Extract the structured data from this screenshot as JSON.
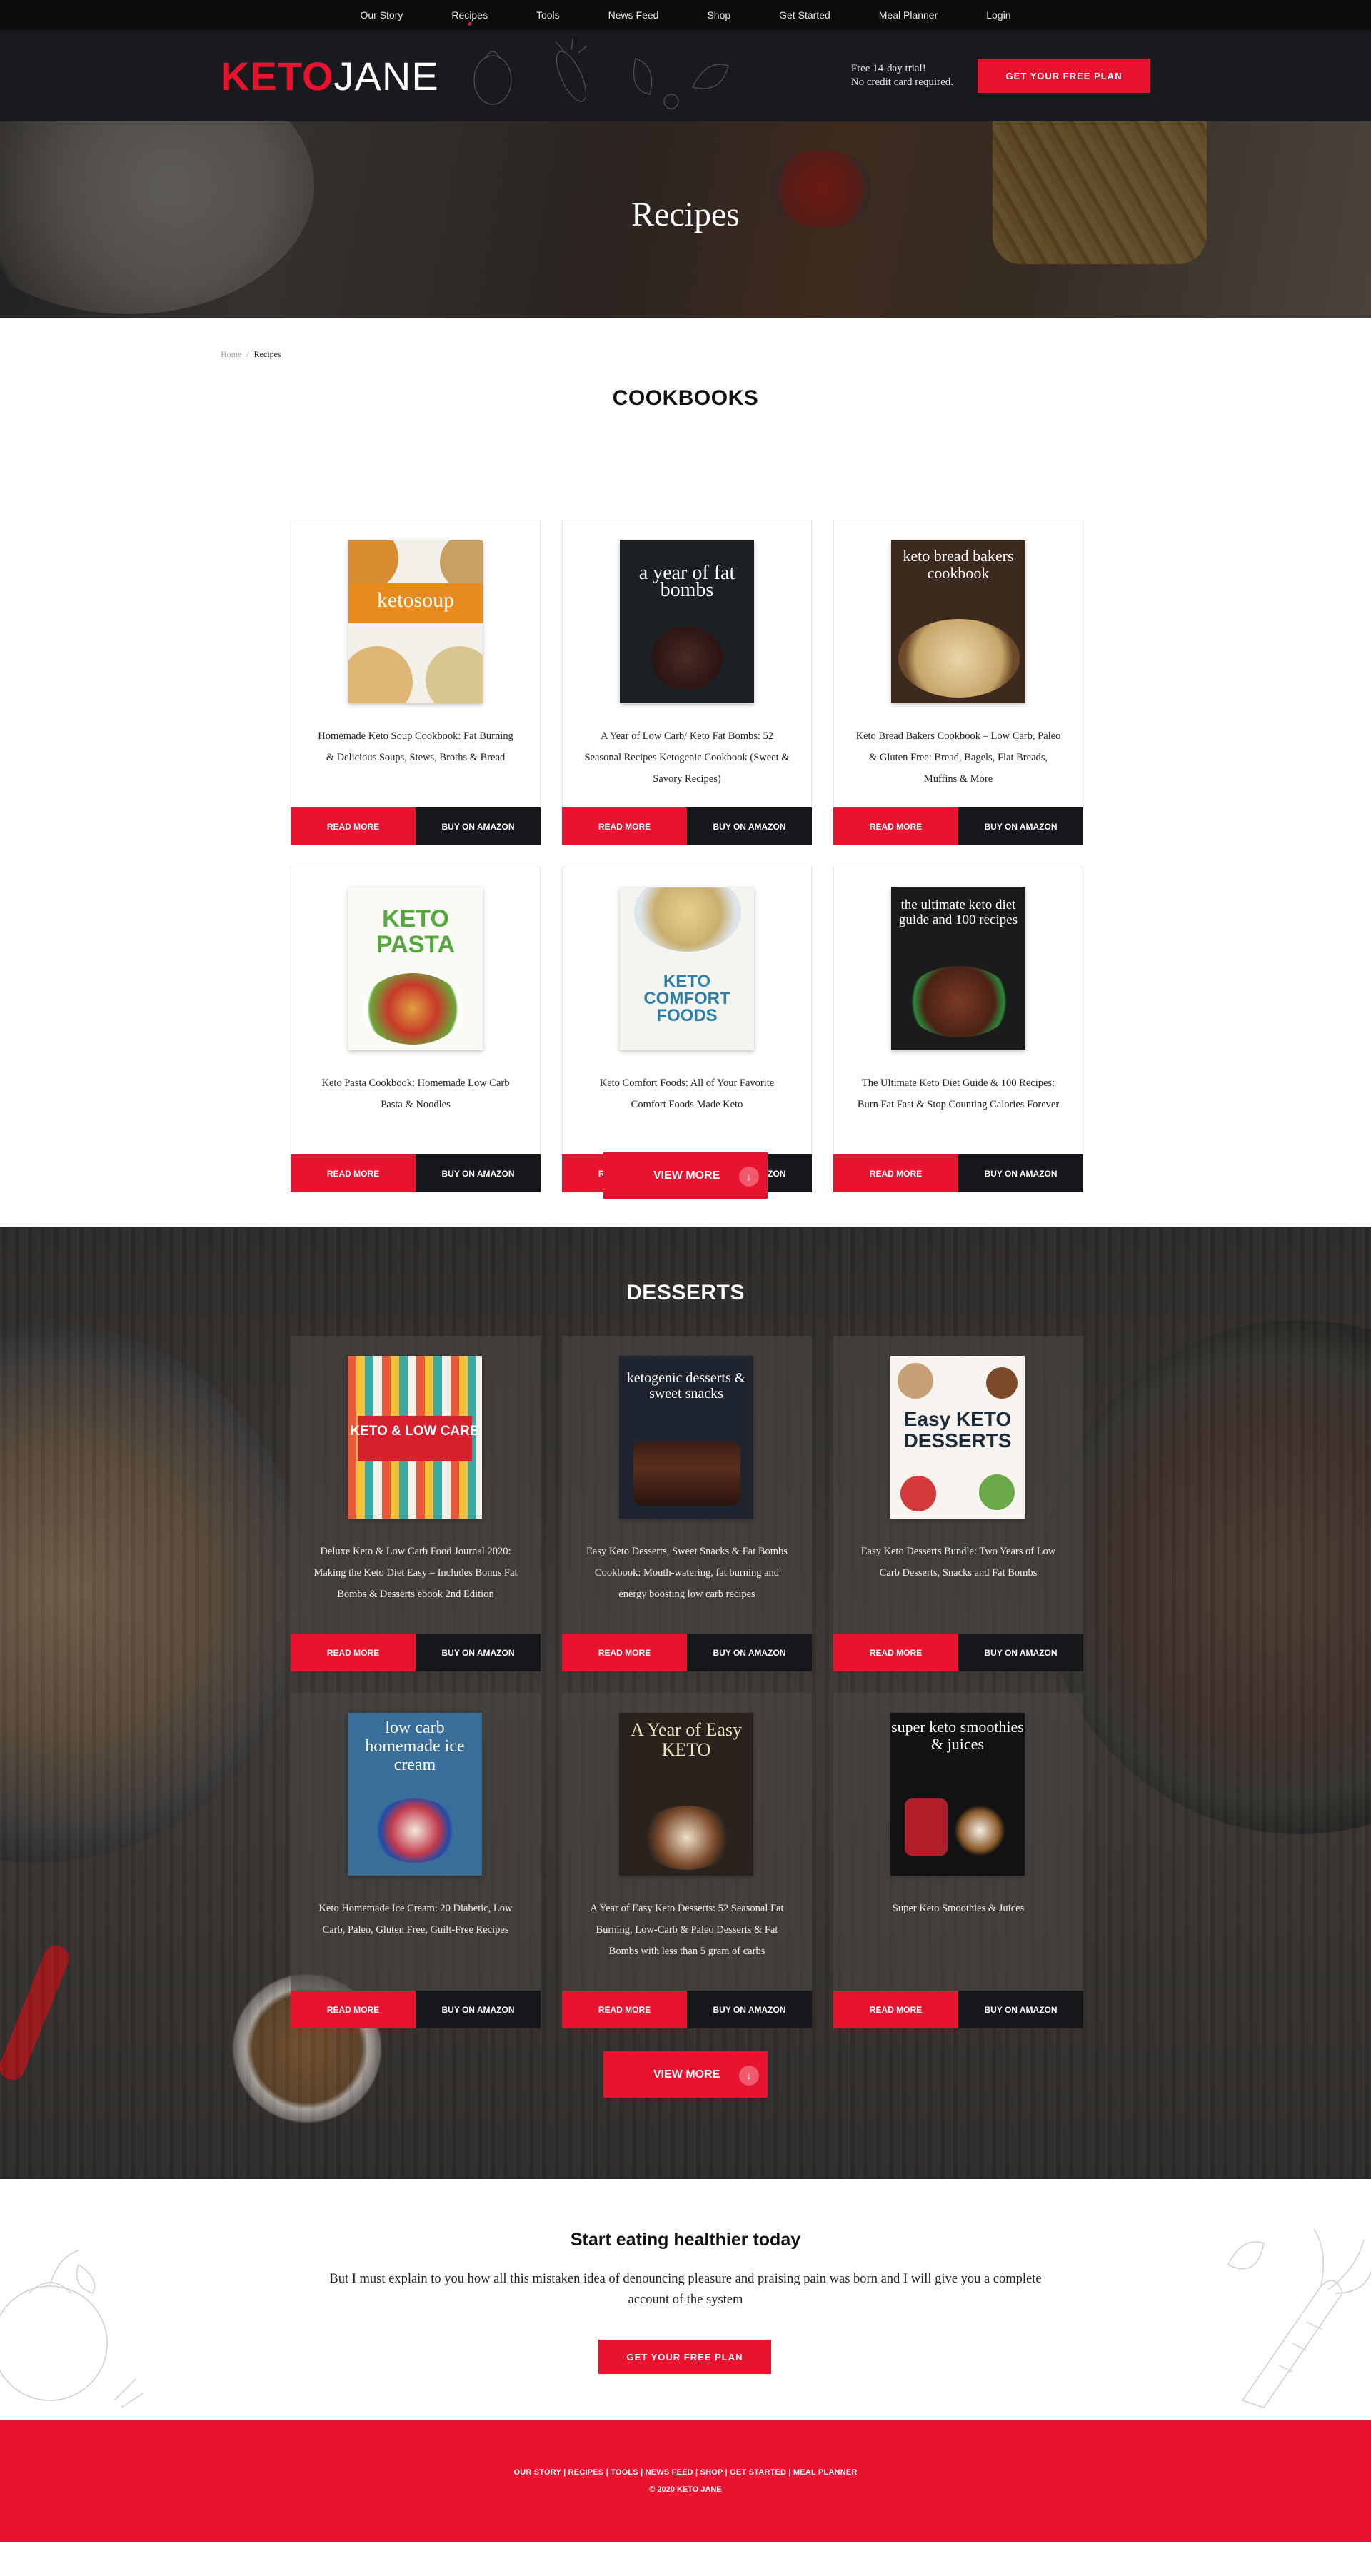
{
  "topnav": {
    "items": [
      "Our Story",
      "Recipes",
      "Tools",
      "News Feed",
      "Shop",
      "Get Started",
      "Meal Planner",
      "Login"
    ]
  },
  "header": {
    "logo_keto": "KETO",
    "logo_jane": "JANE",
    "trial_line1": "Free 14-day trial!",
    "trial_line2": "No credit card required.",
    "cta": "GET YOUR FREE PLAN"
  },
  "hero": {
    "title": "Recipes"
  },
  "breadcrumb": {
    "home": "Home",
    "separator": "/",
    "current": "Recipes"
  },
  "cookbooks": {
    "title": "COOKBOOKS",
    "view_more": "VIEW MORE",
    "cards": [
      {
        "title": "Homemade Keto Soup Cookbook: Fat Burning & Delicious Soups, Stews, Broths & Bread",
        "read": "READ MORE",
        "buy": "BUY ON AMAZON",
        "cover_text": "ketosoup"
      },
      {
        "title": "A Year of Low Carb/ Keto Fat Bombs: 52 Seasonal Recipes Ketogenic Cookbook (Sweet & Savory Recipes)",
        "read": "READ MORE",
        "buy": "BUY ON AMAZON",
        "cover_text": "a year of fat bombs"
      },
      {
        "title": "Keto Bread Bakers Cookbook – Low Carb, Paleo & Gluten Free: Bread, Bagels, Flat Breads, Muffins & More",
        "read": "READ MORE",
        "buy": "BUY ON AMAZON",
        "cover_text": "keto bread bakers cookbook"
      },
      {
        "title": "Keto Pasta Cookbook: Homemade Low Carb Pasta & Noodles",
        "read": "READ MORE",
        "buy": "BUY ON AMAZON",
        "cover_text": "KETO PASTA"
      },
      {
        "title": "Keto Comfort Foods: All of Your Favorite Comfort Foods Made Keto",
        "read": "READ MORE",
        "buy": "BUY ON AMAZON",
        "cover_text": "KETO COMFORT FOODS"
      },
      {
        "title": "The Ultimate Keto Diet Guide & 100 Recipes: Burn Fat Fast & Stop Counting Calories Forever",
        "read": "READ MORE",
        "buy": "BUY ON AMAZON",
        "cover_text": "the ultimate keto diet guide and 100 recipes"
      }
    ]
  },
  "desserts": {
    "title": "DESSERTS",
    "view_more": "VIEW MORE",
    "cards": [
      {
        "title": "Deluxe Keto & Low Carb Food Journal 2020: Making the Keto Diet Easy – Includes Bonus Fat Bombs & Desserts ebook 2nd Edition",
        "read": "READ MORE",
        "buy": "BUY ON AMAZON",
        "cover_text": "KETO & LOW CARB"
      },
      {
        "title": "Easy Keto Desserts, Sweet Snacks & Fat Bombs Cookbook: Mouth-watering, fat burning and energy boosting low carb recipes",
        "read": "READ MORE",
        "buy": "BUY ON AMAZON",
        "cover_text": "ketogenic desserts & sweet snacks"
      },
      {
        "title": "Easy Keto Desserts Bundle: Two Years of Low Carb Desserts, Snacks and Fat Bombs",
        "read": "READ MORE",
        "buy": "BUY ON AMAZON",
        "cover_text": "Easy KETO DESSERTS"
      },
      {
        "title": "Keto Homemade Ice Cream: 20 Diabetic, Low Carb, Paleo, Gluten Free, Guilt-Free Recipes",
        "read": "READ MORE",
        "buy": "BUY ON AMAZON",
        "cover_text": "low carb homemade ice cream"
      },
      {
        "title": "A Year of Easy Keto Desserts: 52 Seasonal Fat Burning, Low-Carb & Paleo Desserts & Fat Bombs with less than 5 gram of carbs",
        "read": "READ MORE",
        "buy": "BUY ON AMAZON",
        "cover_text": "A Year of Easy KETO"
      },
      {
        "title": "Super Keto Smoothies & Juices",
        "read": "READ MORE",
        "buy": "BUY ON AMAZON",
        "cover_text": "super keto smoothies & juices"
      }
    ]
  },
  "cta": {
    "title": "Start eating healthier today",
    "body": "But I must explain to you how all this mistaken idea of denouncing pleasure and praising pain was born and I will give you a complete account of the system",
    "button": "GET YOUR FREE PLAN"
  },
  "footer": {
    "links": "OUR STORY | RECIPES | TOOLS | NEWS FEED | SHOP | GET STARTED | MEAL PLANNER",
    "copyright": "© 2020 KETO JANE"
  },
  "colors": {
    "brand_red": "#e8132f",
    "dark": "#15171b",
    "header_bg": "#181a1e",
    "topnav_bg": "#0b0c0e"
  }
}
